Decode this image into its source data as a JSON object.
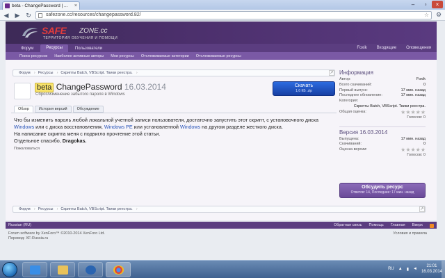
{
  "browser": {
    "tab_title": "beta - ChangePassword | ...",
    "url": "safezone.cc/resources/changepassword.82/"
  },
  "site": {
    "logo_name": "SAFE",
    "logo_name2": "ZONE.cc",
    "tagline": "ТЕРРИТОРИЯ ОБУЧЕНИЯ И ПОМОЩИ",
    "nav_tabs": [
      "Форум",
      "Ресурсы",
      "Пользователи"
    ],
    "nav_right": [
      "Foxik",
      "Входящие",
      "Оповещения"
    ],
    "sub_nav": [
      "Поиск ресурсов",
      "Наиболее активные авторы",
      "Мои ресурсы",
      "Отслеживаемые категории",
      "Отслеживаемые ресурсы"
    ]
  },
  "breadcrumb": [
    "Форум",
    "Ресурсы",
    "Скрипты Batch, VBScript. Твики реестра."
  ],
  "resource": {
    "prefix": "beta",
    "title": "ChangePassword",
    "version_date": "16.03.2014",
    "description": "Сброс/изменение забытого пароля в Windows",
    "download_label": "Скачать",
    "download_sub": "1,6 КБ .zip",
    "tabs": [
      "Обзор",
      "История версий",
      "Обсуждение"
    ],
    "body": {
      "line1": "Что бы изменить пароль любой локальной учетной записи пользователя, достаточно запустить этот скрипт, с установочного диска",
      "line2a": "Windows",
      "line2b": " или с диска восстановления, ",
      "line2c": "Windows PE",
      "line2d": " или установленной ",
      "line2e": "Windows",
      "line2f": " на другом разделе жесткого диска.",
      "line3": "На написание скрипта меня с подвигло прочтение этой статьи.",
      "line4a": "Отдельное спасибо, ",
      "line4b": "Dragokas."
    },
    "report": "Пожаловаться"
  },
  "sidebar": {
    "info_title": "Информация",
    "info": [
      {
        "k": "Автор:",
        "v": "Foxik"
      },
      {
        "k": "Всего скачиваний:",
        "v": "0"
      },
      {
        "k": "Первый выпуск:",
        "v": "17 мин. назад"
      },
      {
        "k": "Последнее обновление:",
        "v": "17 мин. назад"
      },
      {
        "k": "Категория:",
        "v": ""
      }
    ],
    "category": "Скрипты Batch, VBScript. Твики реестра.",
    "rating_label": "Общая оценка:",
    "votes_label": "Голосов: 0",
    "version_title": "Версия 16.03.2014",
    "version_info": [
      {
        "k": "Выпущена:",
        "v": "17 мин. назад"
      },
      {
        "k": "Скачиваний:",
        "v": "0"
      }
    ],
    "version_rating_label": "Оценка версии:",
    "version_votes_label": "Голосов: 0",
    "discuss_label": "Обсудить ресурс",
    "discuss_sub": "Ответов: 14, Последнее: 17 мин. назад"
  },
  "footer": {
    "language": "Russian (RU)",
    "links": [
      "Обратная связь",
      "Помощь",
      "Главная",
      "Вверх"
    ],
    "copyright": "Forum software by XenForo™ ©2010-2014 XenForo Ltd.",
    "translation": "Перевод: XF-Russia.ru",
    "terms": "Условия и правила"
  },
  "taskbar": {
    "lang": "RU",
    "time": "21:01",
    "date": "16.03.2014"
  },
  "colors": {
    "brand_purple": "#5b3d80",
    "download_blue": "#1f55c8",
    "logo_red": "#e13c3c"
  }
}
